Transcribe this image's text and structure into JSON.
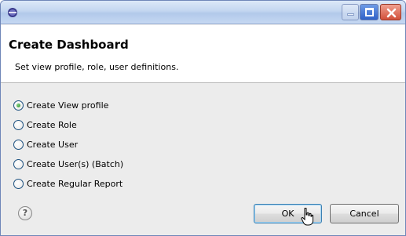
{
  "window": {
    "controls": {
      "minimize_icon": "minimize-icon",
      "maximize_icon": "maximize-icon",
      "close_icon": "close-icon"
    }
  },
  "header": {
    "title": "Create Dashboard",
    "description": "Set view profile, role, user definitions."
  },
  "options": [
    {
      "label": "Create View profile",
      "checked": true
    },
    {
      "label": "Create Role",
      "checked": false
    },
    {
      "label": "Create User",
      "checked": false
    },
    {
      "label": "Create User(s) (Batch)",
      "checked": false
    },
    {
      "label": "Create Regular Report",
      "checked": false
    }
  ],
  "footer": {
    "help_label": "?",
    "ok_label": "OK",
    "cancel_label": "Cancel"
  }
}
